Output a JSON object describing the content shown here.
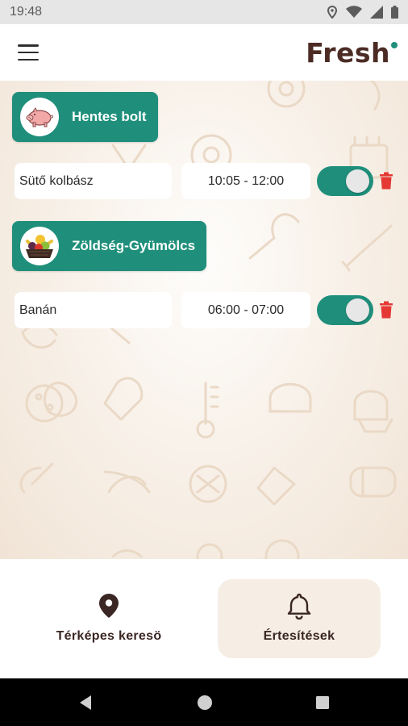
{
  "status_bar": {
    "time": "19:48"
  },
  "app": {
    "logo_text": "Fresh"
  },
  "shops": [
    {
      "name": "Hentes bolt",
      "items": [
        {
          "name": "Sütő kolbász",
          "time": "10:05 - 12:00",
          "enabled": true
        }
      ]
    },
    {
      "name": "Zöldség-Gyümölcs",
      "items": [
        {
          "name": "Banán",
          "time": "06:00 - 07:00",
          "enabled": true
        }
      ]
    }
  ],
  "bottom_nav": [
    {
      "label": "Térképes keresö",
      "icon": "map-pin-icon",
      "active": false
    },
    {
      "label": "Értesítések",
      "icon": "bell-icon",
      "active": true
    }
  ],
  "colors": {
    "accent": "#1f8f7b",
    "brand_text": "#4c2b25",
    "delete": "#e53935",
    "background": "#f6ede4"
  }
}
